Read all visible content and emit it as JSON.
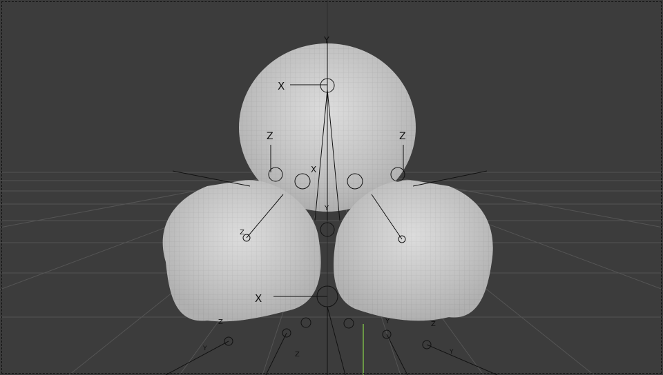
{
  "viewport": {
    "background": "#3c3c3c",
    "grid_color": "#5a5a5a",
    "mesh_color": "#d8d8d8",
    "rig_color": "#111111",
    "y_axis_color": "#7ab648"
  },
  "axis_labels": {
    "y": "Y",
    "x": "X",
    "z": "Z"
  },
  "scene": {
    "object": "sculpted-mesh",
    "rig": "armature"
  }
}
